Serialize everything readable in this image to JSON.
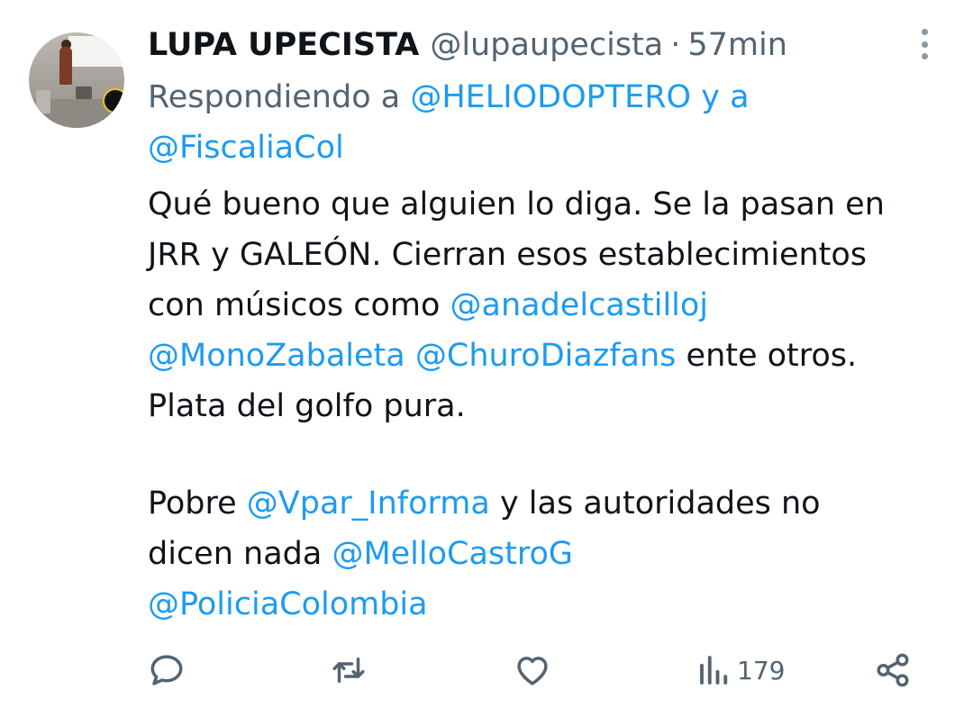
{
  "tweet": {
    "author_name": "LUPA UPECISTA",
    "author_handle": "@lupaupecista",
    "separator": "·",
    "time": "57min",
    "reply_prefix": "Respondiendo a ",
    "reply_users": [
      "@HELIODOPTERO",
      "@FiscaliaCol"
    ],
    "reply_joiner": " y a",
    "body": {
      "l1": "Qué bueno que alguien lo diga. Se la pasan en",
      "l2": "JRR y GALEÓN. Cierran esos establecimientos",
      "l3_text": "con músicos como ",
      "l3_mention": "@anadelcastilloj",
      "l4_mention1": "@MonoZabaleta",
      "l4_mention2": "@ChuroDiazfans",
      "l4_text": " ente otros.",
      "l5": "Plata del golfo pura.",
      "l6_text1": "Pobre ",
      "l6_mention": "@Vpar_Informa",
      "l6_text2": " y las autoridades no",
      "l7_text": "dicen nada ",
      "l7_mention": "@MelloCastroG",
      "l8_mention": "@PoliciaColombia"
    }
  },
  "actions": {
    "views_count": "179",
    "icons": [
      "reply-icon",
      "retweet-icon",
      "like-icon",
      "views-icon",
      "share-icon"
    ]
  },
  "colors": {
    "link": "#1d9bf0",
    "muted": "#536471",
    "text": "#0f1419"
  }
}
